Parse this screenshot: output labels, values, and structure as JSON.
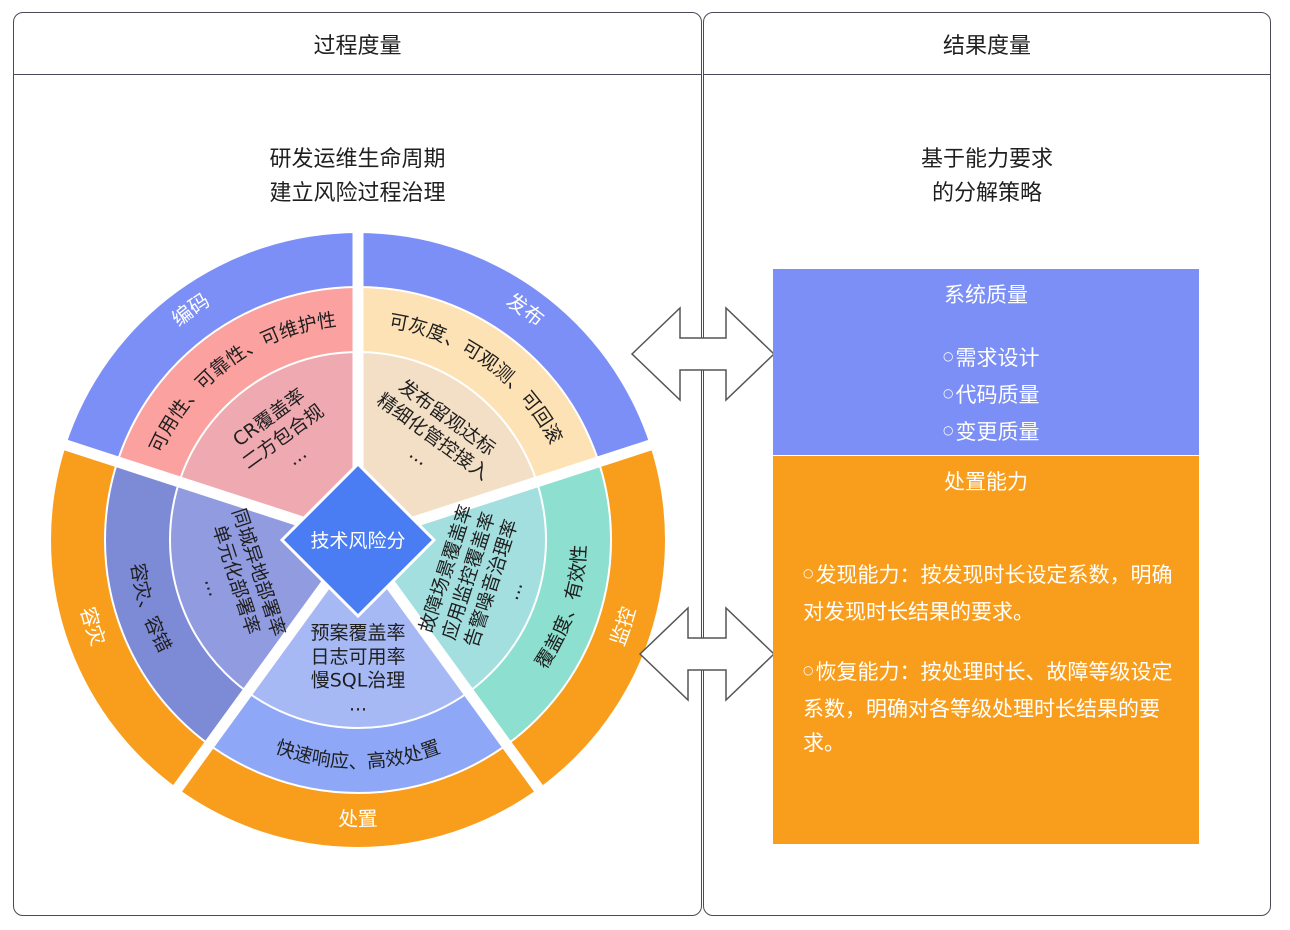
{
  "left_panel": {
    "header": "过程度量",
    "subtitle_line1": "研发运维生命周期",
    "subtitle_line2": "建立风险过程治理"
  },
  "right_panel": {
    "header": "结果度量",
    "subtitle_line1": "基于能力要求",
    "subtitle_line2": "的分解策略"
  },
  "wheel": {
    "center": "技术风险分",
    "segments": {
      "coding": {
        "outer": "编码",
        "middle": "可用性、可靠性、可维护性",
        "inner1": "CR覆盖率",
        "inner2": "二方包合规",
        "inner3": "..."
      },
      "release": {
        "outer": "发布",
        "middle": "可灰度、可观测、可回滚",
        "inner1": "发布留观达标",
        "inner2": "精细化管控接入",
        "inner3": "..."
      },
      "monitor": {
        "outer": "监控",
        "middle": "覆盖度、有效性",
        "inner1": "故障场景覆盖率",
        "inner2": "应用监控覆盖率",
        "inner3": "告警噪音治理率",
        "inner4": "..."
      },
      "handling": {
        "outer": "处置",
        "middle": "快速响应、高效处置",
        "inner1": "预案覆盖率",
        "inner2": "日志可用率",
        "inner3": "慢SQL治理",
        "inner4": "..."
      },
      "disaster": {
        "outer": "容灾",
        "middle": "容灾、容错",
        "inner1": "同城异地部署率",
        "inner2": "单元化部署率",
        "inner3": "..."
      }
    },
    "colors": {
      "outer_blue": "#7b8ff6",
      "outer_orange": "#f99e1c",
      "coding_middle": "#fba2a0",
      "coding_inner": "#efaab1",
      "release_middle": "#fde2b5",
      "release_inner": "#f3dfc6",
      "monitor_middle": "#8de0cf",
      "monitor_inner": "#a4dfe0",
      "handling_middle": "#8ea8f7",
      "handling_inner": "#a7b9f5",
      "disaster_middle": "#7d8bd6",
      "disaster_inner": "#919be0",
      "center": "#4a7cf3"
    }
  },
  "quality_box": {
    "title": "系统质量",
    "items": [
      "需求设计",
      "代码质量",
      "变更质量"
    ]
  },
  "handling_box": {
    "title": "处置能力",
    "items": [
      "发现能力：按发现时长设定系数，明确对发现时长结果的要求。",
      "恢复能力：按处理时长、故障等级设定系数，明确对各等级处理时长结果的要求。"
    ]
  }
}
